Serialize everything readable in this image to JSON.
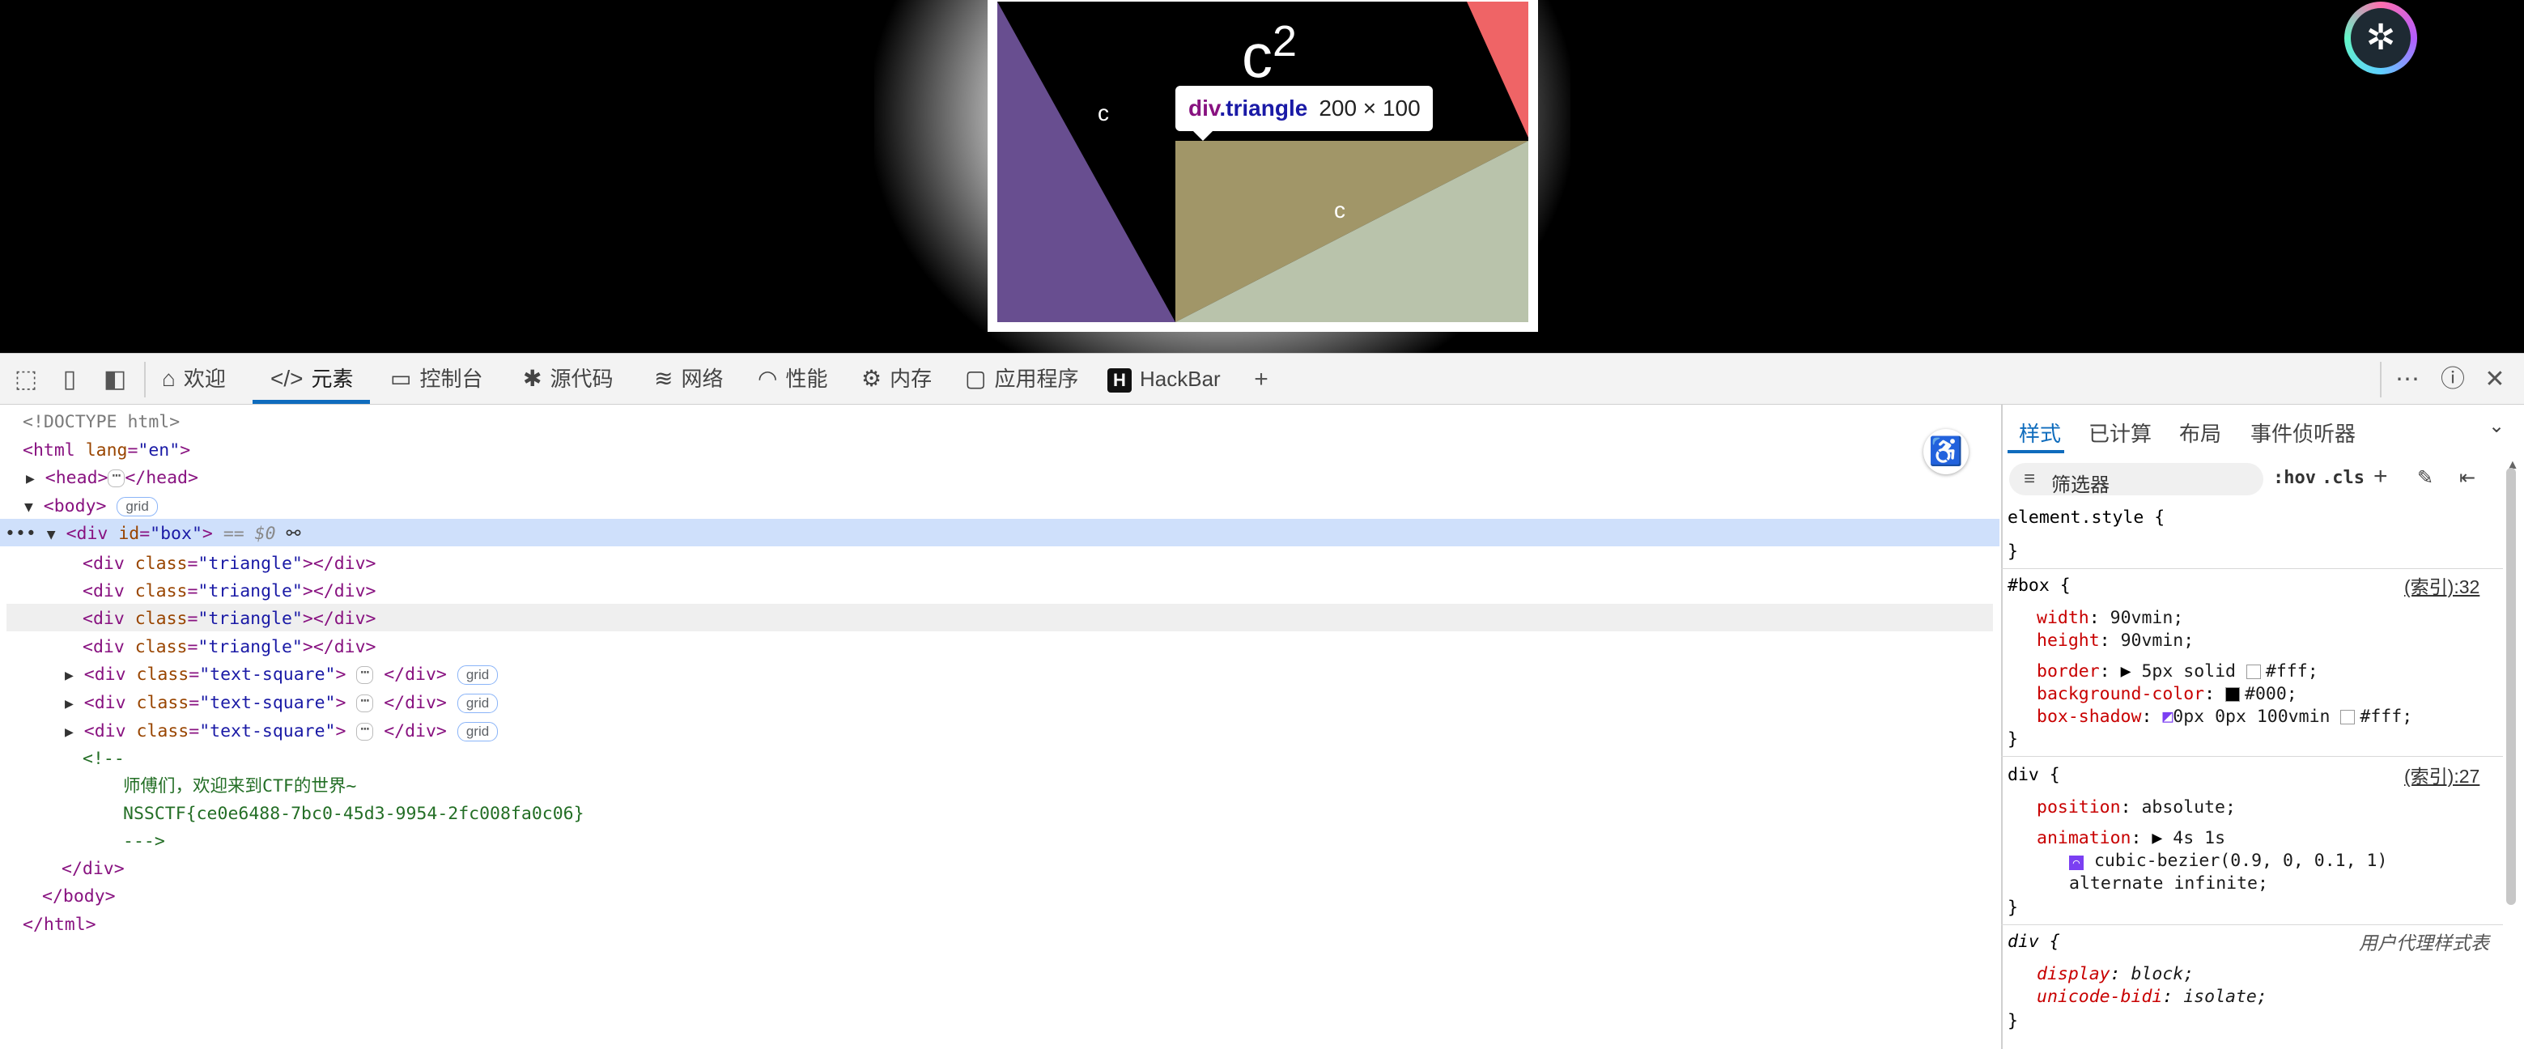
{
  "viewport": {
    "formula": "c",
    "formula_sup": "2",
    "label_left": "c",
    "label_center": "c",
    "tooltip": {
      "tag": "div",
      "cls": ".triangle",
      "dims": "200 × 100"
    }
  },
  "toolbar": {
    "tabs": [
      {
        "label": "欢迎",
        "icon": "home-icon"
      },
      {
        "label": "元素",
        "icon": "code-icon"
      },
      {
        "label": "控制台",
        "icon": "console-icon"
      },
      {
        "label": "源代码",
        "icon": "bug-icon"
      },
      {
        "label": "网络",
        "icon": "wifi-icon"
      },
      {
        "label": "性能",
        "icon": "performance-icon"
      },
      {
        "label": "内存",
        "icon": "memory-icon"
      },
      {
        "label": "应用程序",
        "icon": "application-icon"
      },
      {
        "label": "HackBar",
        "icon": "hackbar-icon"
      }
    ],
    "active_tab": "元素"
  },
  "dom": {
    "doctype": "<!DOCTYPE html>",
    "html_open": "<html",
    "html_lang_attr": "lang",
    "html_lang_val": "\"en\"",
    "head_open": "<head>",
    "head_close": "</head>",
    "body_open": "<body>",
    "div_open": "<div",
    "id_attr": "id",
    "box_id": "\"box\"",
    "eq_sel": "== $0",
    "class_attr": "class",
    "triangle_class": "\"triangle\"",
    "text_square_class": "\"text-square\"",
    "gt": ">",
    "div_close": "</div>",
    "comment_open": "<!--",
    "comment_line1": "师傅们，欢迎来到CTF的世界~",
    "comment_line2": "NSSCTF{ce0e6488-7bc0-45d3-9954-2fc008fa0c06}",
    "comment_close": "--->",
    "body_close": "</body>",
    "html_close": "</html>",
    "grid_badge": "grid"
  },
  "styles": {
    "tabs": [
      "样式",
      "已计算",
      "布局",
      "事件侦听器"
    ],
    "filter_placeholder": "筛选器",
    "hov": ":hov",
    "cls": ".cls",
    "element_style": "element.style {",
    "close_brace": "}",
    "box_selector": "#box {",
    "box_source": "(索引):32",
    "box_props": [
      {
        "name": "width",
        "value": "90vmin;"
      },
      {
        "name": "height",
        "value": "90vmin;"
      },
      {
        "name": "border",
        "value": "5px solid",
        "swatch": "#fff",
        "tail": "#fff;"
      },
      {
        "name": "background-color",
        "swatch": "#000",
        "tail": "#000;"
      },
      {
        "name": "box-shadow",
        "value": "0px 0px 100vmin",
        "swatch": "#fff",
        "tail": "#fff;"
      }
    ],
    "div_selector": "div {",
    "div_source": "(索引):27",
    "div_position_name": "position",
    "div_position_value": "absolute;",
    "div_animation_name": "animation",
    "div_animation_value": "4s 1s",
    "div_animation_bezier": "cubic-bezier(0.9, 0, 0.1, 1)",
    "div_animation_tail": "alternate infinite;",
    "ua_selector": "div {",
    "ua_label": "用户代理样式表",
    "ua_display_name": "display",
    "ua_display_value": "block;",
    "ua_bidi_name": "unicode-bidi",
    "ua_bidi_value": "isolate;"
  }
}
